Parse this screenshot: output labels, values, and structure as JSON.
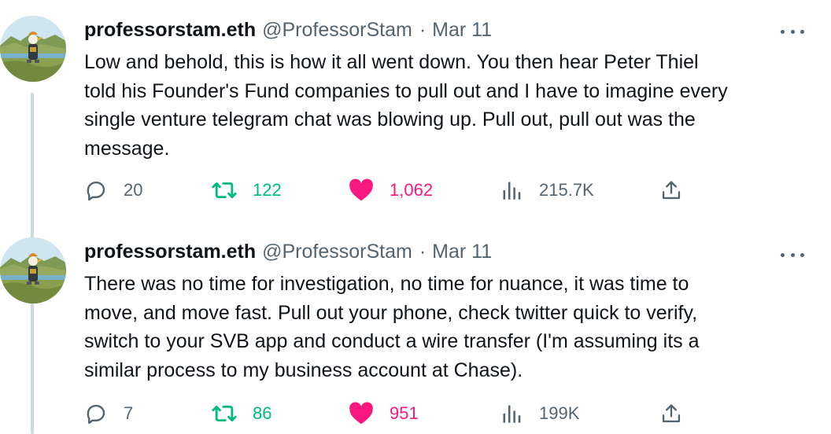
{
  "colors": {
    "text": "#0f1419",
    "secondary": "#536471",
    "retweet_active": "#00ba7c",
    "like_active": "#f91880",
    "thread_line": "#cfd9de"
  },
  "tweets": [
    {
      "display_name": "professorstam.eth",
      "handle": "@ProfessorStam",
      "separator": "·",
      "date": "Mar 11",
      "text": "Low and behold, this is how it all went down.  You then hear Peter Thiel\ntold his Founder's Fund companies to pull out and I have to imagine every\nsingle venture telegram chat was blowing up.  Pull out, pull out was the\nmessage.",
      "replies": "20",
      "retweets": "122",
      "likes": "1,062",
      "views": "215.7K",
      "retweeted": true,
      "liked": true,
      "icons": {
        "reply": "reply-icon",
        "retweet": "retweet-icon",
        "like": "heart-icon",
        "views": "views-icon",
        "share": "share-icon",
        "more": "more-icon"
      }
    },
    {
      "display_name": "professorstam.eth",
      "handle": "@ProfessorStam",
      "separator": "·",
      "date": "Mar 11",
      "text": "There was no time for investigation, no time for nuance, it was time to\nmove, and move fast.  Pull out your phone, check twitter quick to verify,\nswitch to your SVB app and conduct a wire transfer (I'm assuming its a\nsimilar process to my business account at Chase).",
      "replies": "7",
      "retweets": "86",
      "likes": "951",
      "views": "199K",
      "retweeted": true,
      "liked": true,
      "icons": {
        "reply": "reply-icon",
        "retweet": "retweet-icon",
        "like": "heart-icon",
        "views": "views-icon",
        "share": "share-icon",
        "more": "more-icon"
      }
    }
  ]
}
